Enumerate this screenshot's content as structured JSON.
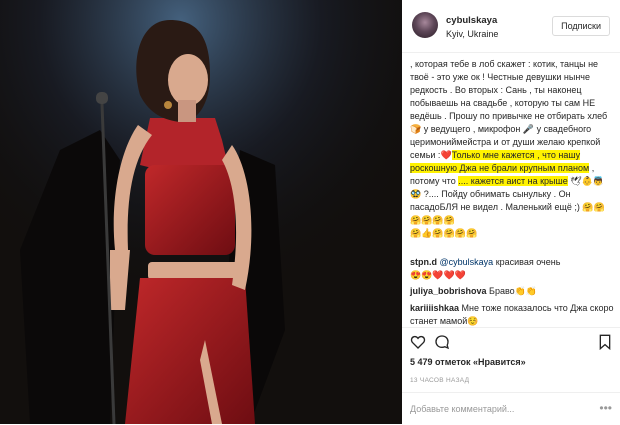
{
  "post": {
    "username": "cybulskaya",
    "location": "Kyiv, Ukraine",
    "follow_label": "Подписки"
  },
  "caption": {
    "p1": ", которая тебе в лоб скажет : котик, танцы не твоё - это уже ок ! Честные девушки нынче редкость . Во вторых : Сань , ты наконец побываешь на свадьбе , которую ты сам НЕ ведёшь . Прошу по привычке не отбирать хлеб ",
    "e1": "🍞",
    "p2": " у ведущего , микрофон ",
    "e2": "🎤",
    "p3": " у свадебного церимониймейстра и от души желаю крепкой семьи ",
    "e3": ":",
    "e4": "❤️",
    "hl1": "Только мне кажется , что нашу роскошную Джа не брали крупным планом",
    "p4": " , потому что ",
    "hl2": ".... кажется аист на крыше",
    "e5": "🕊👶👼🥸",
    "p5": " ?.... Пойду обнимать сынульку . Он пасадоБЛЯ не видел . Маленький ещё ;) ",
    "e6": "🤗🤗🤗🤗🤗🤗",
    "e7": "🤗👍🤗🤗🤗🤗"
  },
  "comments": [
    {
      "user": "stpn.d",
      "mention": "@cybulskaya",
      "text": " красивая очень",
      "emoji": "😍😍❤️❤️❤️"
    },
    {
      "user": "juliya_bobrishova",
      "text": " Браво",
      "emoji": "👏👏"
    },
    {
      "user": "kariiiishkaa",
      "text": " Мне тоже показалось что Джа скоро станет мамой",
      "emoji": "☺️"
    }
  ],
  "stats": {
    "likes": "5 479 отметок «Нравится»",
    "time": "13 ЧАСОВ НАЗАД"
  },
  "comment_box": {
    "placeholder": "Добавьте комментарий..."
  },
  "icons": {
    "like": "heart-icon",
    "comment": "comment-bubble-icon",
    "bookmark": "bookmark-icon",
    "more": "more-options-icon"
  }
}
